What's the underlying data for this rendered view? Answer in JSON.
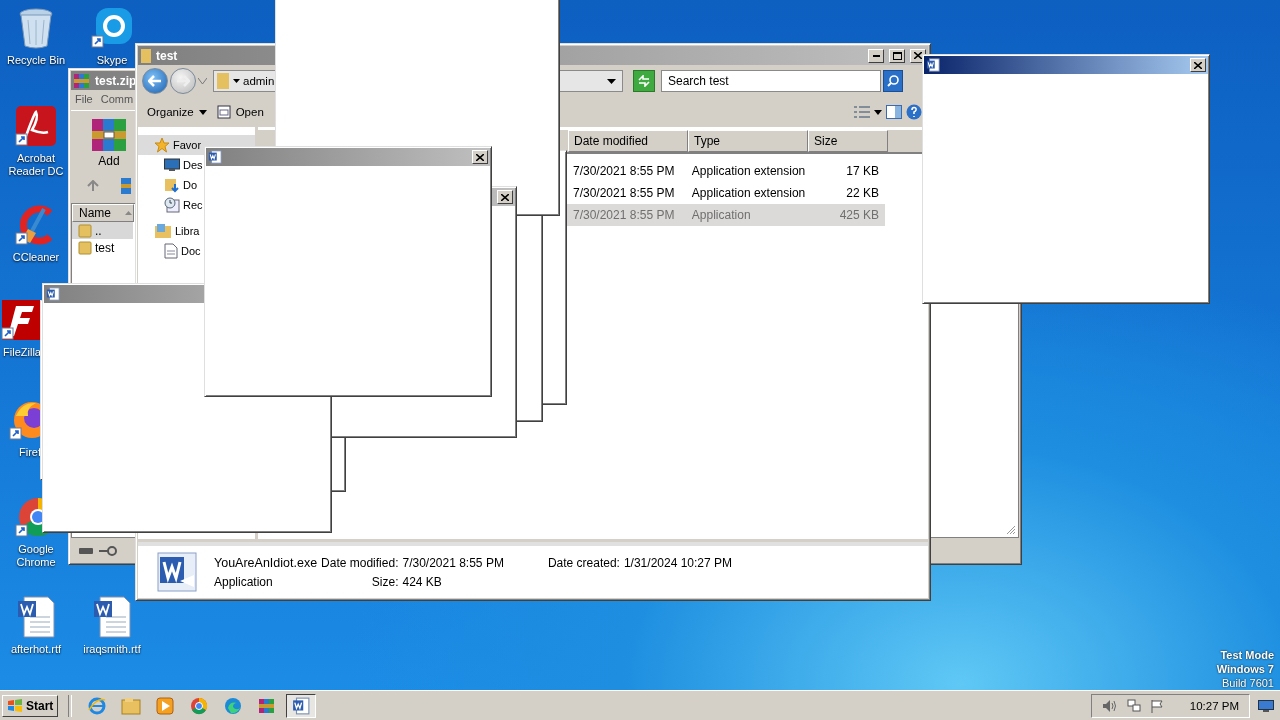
{
  "desktop_icons": [
    {
      "label": "Recycle Bin",
      "kind": "recycle-bin"
    },
    {
      "label": "Skype",
      "kind": "skype"
    },
    {
      "label": "Acrobat Reader DC",
      "kind": "acrobat"
    },
    {
      "label": "CCleaner",
      "kind": "ccleaner"
    },
    {
      "label": "FileZilla",
      "kind": "filezilla"
    },
    {
      "label": "Firef",
      "kind": "firefox"
    },
    {
      "label": "Google Chrome",
      "kind": "chrome"
    },
    {
      "label": "afterhot.rtf",
      "kind": "word-doc"
    },
    {
      "label": "iraqsmith.rtf",
      "kind": "word-doc"
    }
  ],
  "archive_window": {
    "title": "test.zip",
    "menu": [
      "File",
      "Comm"
    ],
    "toolbar": [
      "Add"
    ],
    "column": "Name",
    "items": [
      {
        "name": "..",
        "selected": true
      },
      {
        "name": "test",
        "selected": false
      }
    ]
  },
  "explorer_window": {
    "title": "test",
    "address": "admin",
    "search": {
      "placeholder": "Search test"
    },
    "toolbar": [
      "Organize",
      "Open"
    ],
    "nav": [
      {
        "label": "Favor",
        "kind": "star",
        "selected": true,
        "children": [
          {
            "label": "Des",
            "kind": "desktop",
            "selected": false
          },
          {
            "label": "Do",
            "kind": "downloads",
            "selected": false
          },
          {
            "label": "Rec",
            "kind": "recent",
            "selected": false
          }
        ]
      },
      {
        "label": "Libra",
        "kind": "library",
        "selected": false,
        "children": [
          {
            "label": "Doc",
            "kind": "documents",
            "selected": false
          }
        ]
      }
    ],
    "columns": [
      "Date modified",
      "Type",
      "Size"
    ],
    "rows": [
      {
        "date_modified": "7/30/2021 8:55 PM",
        "type": "Application extension",
        "size": "17 KB",
        "selected": false
      },
      {
        "date_modified": "7/30/2021 8:55 PM",
        "type": "Application extension",
        "size": "22 KB",
        "selected": false
      },
      {
        "date_modified": "7/30/2021 8:55 PM",
        "type": "Application",
        "size": "425 KB",
        "selected": true
      }
    ],
    "details": {
      "name": "YouAreAnIdiot.exe",
      "type": "Application",
      "date_modified_label": "Date modified:",
      "date_modified": "7/30/2021 8:55 PM",
      "date_created_label": "Date created:",
      "date_created": "1/31/2024 10:27 PM",
      "size_label": "Size:",
      "size": "424 KB"
    }
  },
  "popups": [
    {
      "kind": "untitled"
    },
    {
      "kind": "untitled"
    },
    {
      "kind": "untitled"
    },
    {
      "kind": "untitled"
    },
    {
      "kind": "untitled"
    },
    {
      "kind": "close-only",
      "active": false
    },
    {
      "kind": "icon-only",
      "active": false
    },
    {
      "kind": "window",
      "active": false
    },
    {
      "kind": "window",
      "active": true
    }
  ],
  "taskbar": {
    "start": "Start",
    "items": [
      {
        "kind": "ie",
        "selected": false
      },
      {
        "kind": "folder",
        "selected": false
      },
      {
        "kind": "media-player",
        "selected": false
      },
      {
        "kind": "chrome",
        "selected": false
      },
      {
        "kind": "edge",
        "selected": false
      },
      {
        "kind": "winrar",
        "selected": false
      },
      {
        "kind": "word",
        "selected": true
      }
    ],
    "clock": "10:27 PM"
  },
  "desktop_notice": [
    "Test Mode",
    "Windows 7",
    "Build 7601"
  ]
}
